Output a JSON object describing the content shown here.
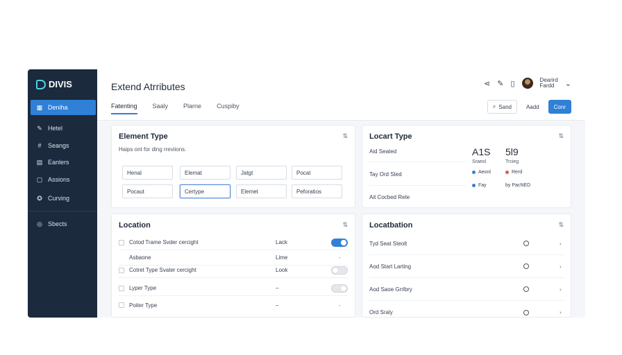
{
  "brand": {
    "name": "DIVIS"
  },
  "sidebar": {
    "items": [
      {
        "label": "Deniha",
        "icon": "dashboard-icon",
        "glyph": "▦",
        "active": true
      },
      {
        "label": "Hetel",
        "icon": "brush-icon",
        "glyph": "✎",
        "active": false
      },
      {
        "label": "Seangs",
        "icon": "hash-icon",
        "glyph": "#",
        "active": false
      },
      {
        "label": "Eanlers",
        "icon": "grid-icon",
        "glyph": "▤",
        "active": false
      },
      {
        "label": "Assions",
        "icon": "chat-icon",
        "glyph": "▢",
        "active": false
      },
      {
        "label": "Curving",
        "icon": "plugin-icon",
        "glyph": "✪",
        "active": false
      },
      {
        "label": "Sbects",
        "icon": "settings-icon",
        "glyph": "◎",
        "active": false
      }
    ]
  },
  "header": {
    "title": "Extend Atrributes",
    "user": {
      "line1": "Dearird",
      "line2": "Fardd"
    },
    "tabs": [
      {
        "label": "Fatenting",
        "active": true
      },
      {
        "label": "Saaly",
        "active": false
      },
      {
        "label": "Plarne",
        "active": false
      },
      {
        "label": "Cuspiby",
        "active": false
      }
    ],
    "search_label": "Sand",
    "add_label": "Aadd",
    "primary_label": "Conr"
  },
  "element_type": {
    "title": "Element Type",
    "hint": "Haips ont for ding rreviions.",
    "tags": [
      "Henal",
      "Elemat",
      "Jatgt",
      "Pocat",
      "Pocaut",
      "Certype",
      "Elemet",
      "Peforatios"
    ]
  },
  "locart_type": {
    "title": "Locart Type",
    "rows": [
      "Aid Seated",
      "Tay Ord Sted",
      "Ait Cocbed Rete"
    ],
    "stats": [
      {
        "num": "A1S",
        "sub": "Sraeol"
      },
      {
        "num": "5l9",
        "sub": "Trcieg"
      }
    ],
    "legend": [
      {
        "label": "Aeonl",
        "color": "#2f80d6"
      },
      {
        "label": "Rerd",
        "color": "#e0564f"
      },
      {
        "label": "Fay",
        "color": "#2f80d6"
      },
      {
        "label": "by PacNED",
        "color": "#8a94a3"
      }
    ]
  },
  "location": {
    "title": "Location",
    "rows": [
      {
        "label": "Cotod Trame Svder cercight",
        "value": "Lack",
        "control": "toggle-on"
      },
      {
        "label": "Asbaone",
        "value": "Lime",
        "control": "dash"
      },
      {
        "label": "Cotret Type Svater cercight",
        "value": "Look",
        "control": "toggle-off"
      },
      {
        "label": "Lyper Type",
        "value": "–",
        "control": "toggle-off-dot"
      },
      {
        "label": "Poiter Type",
        "value": "–",
        "control": "dash"
      }
    ]
  },
  "locatbation": {
    "title": "Locatbation",
    "rows": [
      "Tyd Seat Steolt",
      "Aod Start Larting",
      "Aod Saoe Grrlbry",
      "Ord Sraly"
    ]
  }
}
